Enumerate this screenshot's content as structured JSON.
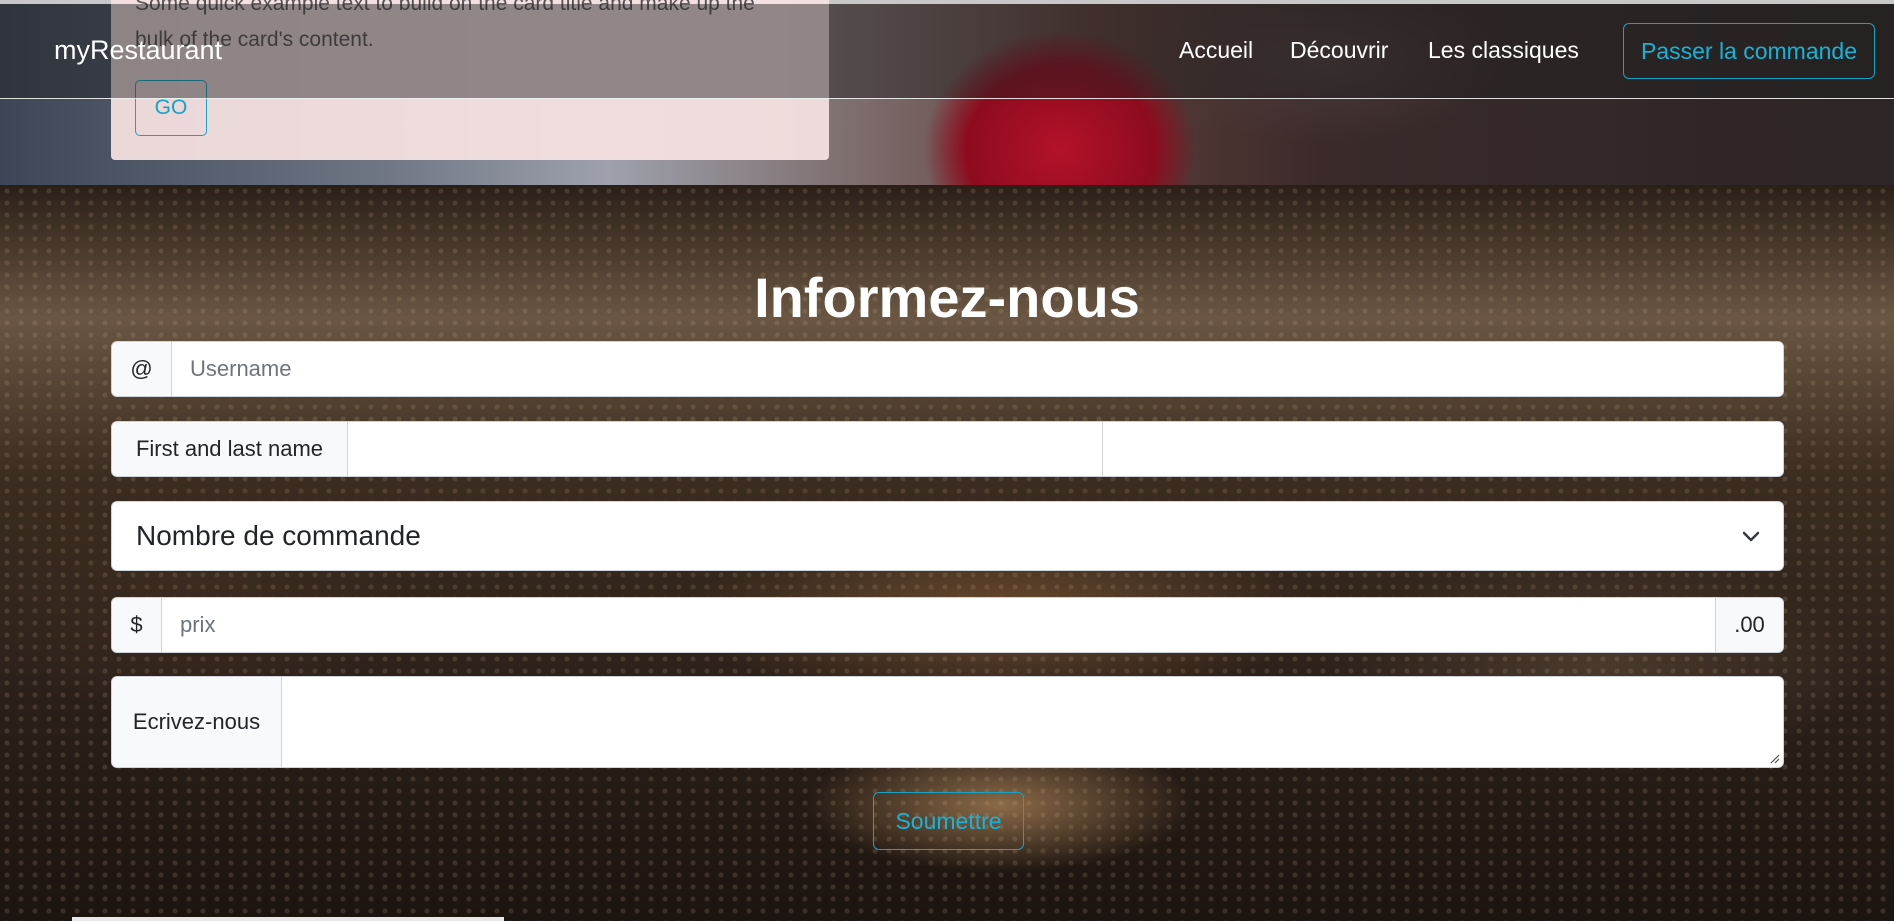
{
  "card": {
    "text": "Some quick example text to build on the card title and make up the bulk of the card's content.",
    "button_label": "GO"
  },
  "navbar": {
    "brand": "myRestaurant",
    "links": [
      "Accueil",
      "Découvrir",
      "Les classiques"
    ],
    "cta_label": "Passer la commande"
  },
  "form": {
    "title": "Informez-nous",
    "username": {
      "prefix": "@",
      "placeholder": "Username",
      "value": ""
    },
    "name": {
      "label": "First and last name",
      "first_value": "",
      "last_value": ""
    },
    "order_select": {
      "selected": "Nombre de commande"
    },
    "price": {
      "prefix": "$",
      "placeholder": "prix",
      "suffix": ".00",
      "value": ""
    },
    "message": {
      "label": "Ecrivez-nous",
      "value": ""
    },
    "submit_label": "Soumettre"
  },
  "colors": {
    "accent": "#17a2c7",
    "card_bg": "#f8e2e2"
  }
}
